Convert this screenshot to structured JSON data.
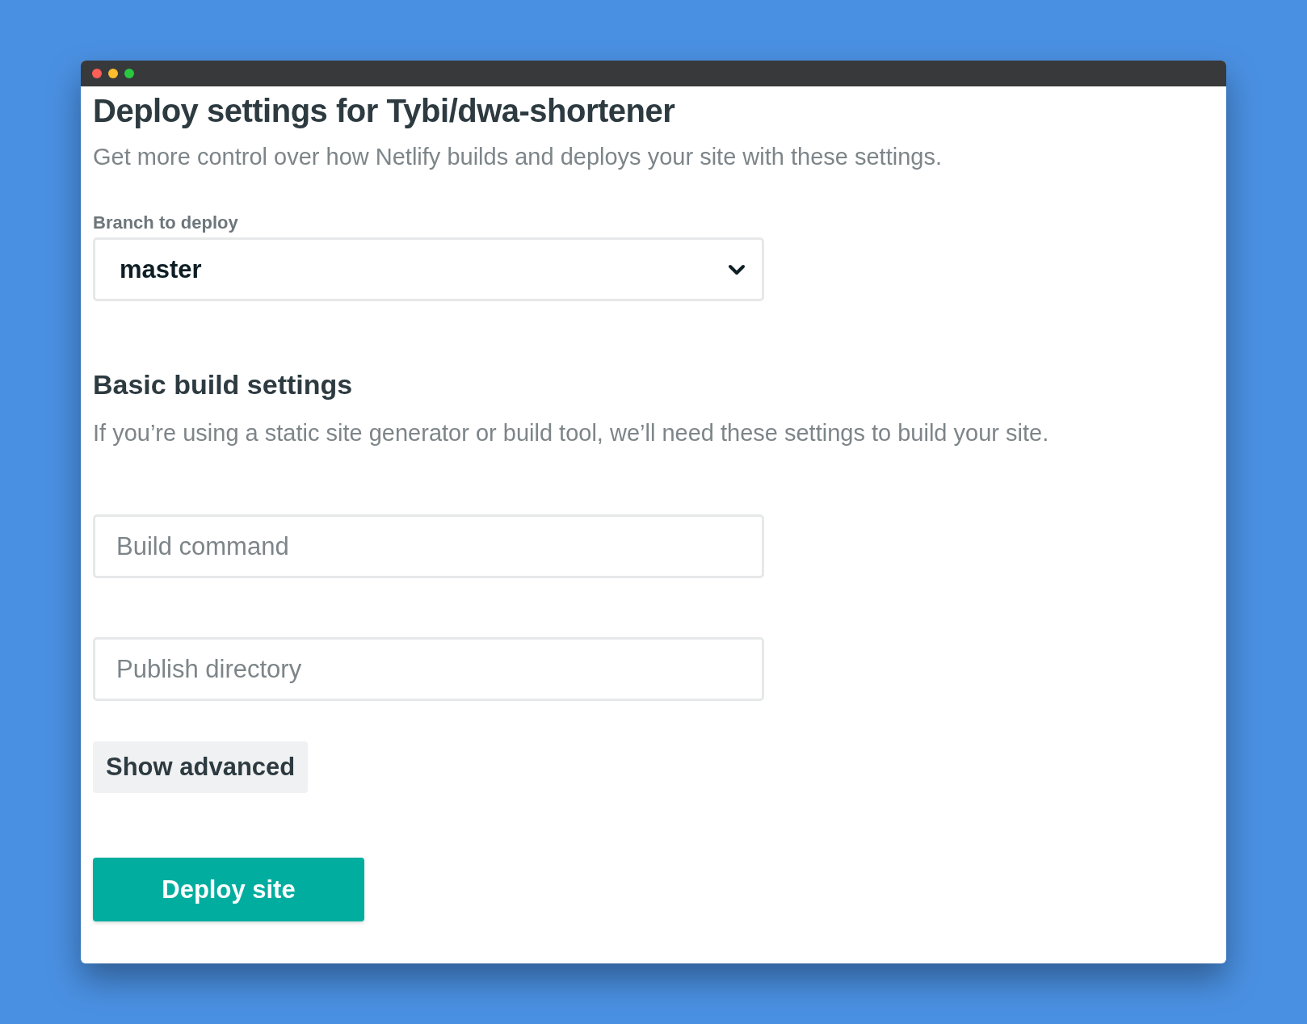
{
  "title": "Deploy settings for Tybi/dwa-shortener",
  "subtitle": "Get more control over how Netlify builds and deploys your site with these settings.",
  "branch": {
    "label": "Branch to deploy",
    "value": "master"
  },
  "section": {
    "heading": "Basic build settings",
    "description": "If you’re using a static site generator or build tool, we’ll need these settings to build your site."
  },
  "fields": [
    {
      "placeholder": "Build command"
    },
    {
      "placeholder": "Publish directory"
    }
  ],
  "buttons": [
    {
      "label": "Show advanced",
      "kind": "secondary"
    },
    {
      "label": "Deploy site",
      "kind": "primary"
    }
  ]
}
